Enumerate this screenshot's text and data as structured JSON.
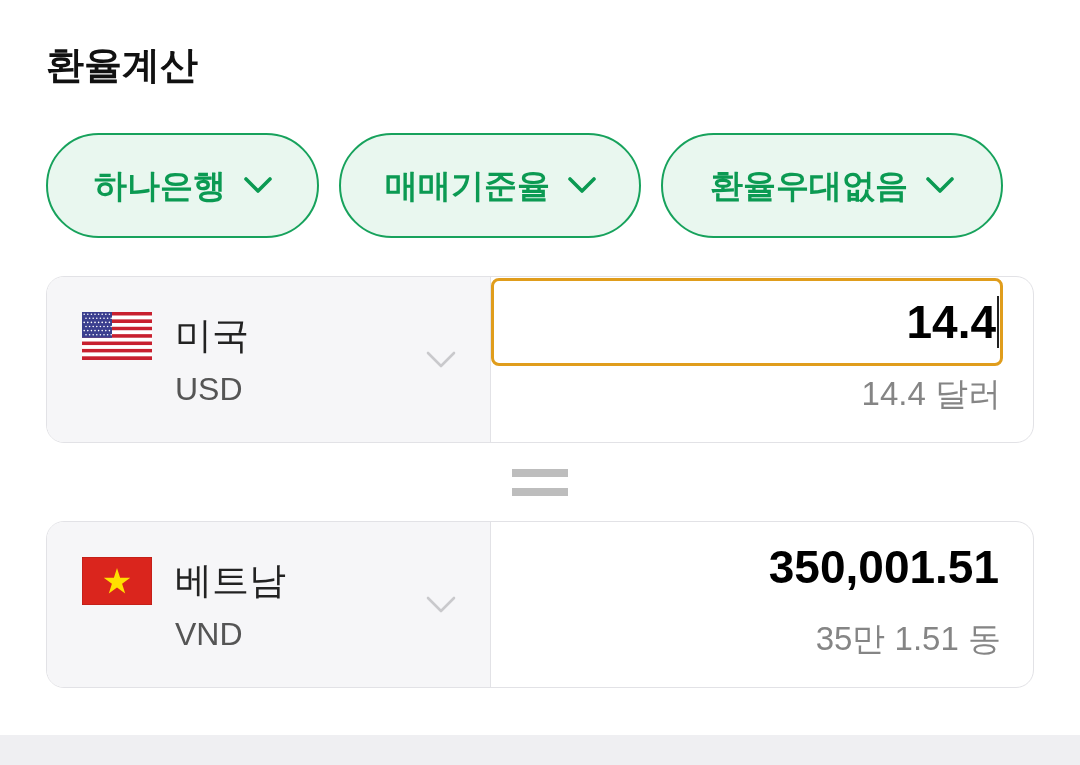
{
  "title": "환율계산",
  "filters": [
    {
      "label": "하나은행"
    },
    {
      "label": "매매기준율"
    },
    {
      "label": "환율우대없음"
    }
  ],
  "converter": {
    "rows": [
      {
        "country": "미국",
        "code": "USD",
        "amount": "14.4",
        "reading": "14.4 달러",
        "focused": true
      },
      {
        "country": "베트남",
        "code": "VND",
        "amount": "350,001.51",
        "reading": "35만 1.51 동",
        "focused": false
      }
    ]
  }
}
